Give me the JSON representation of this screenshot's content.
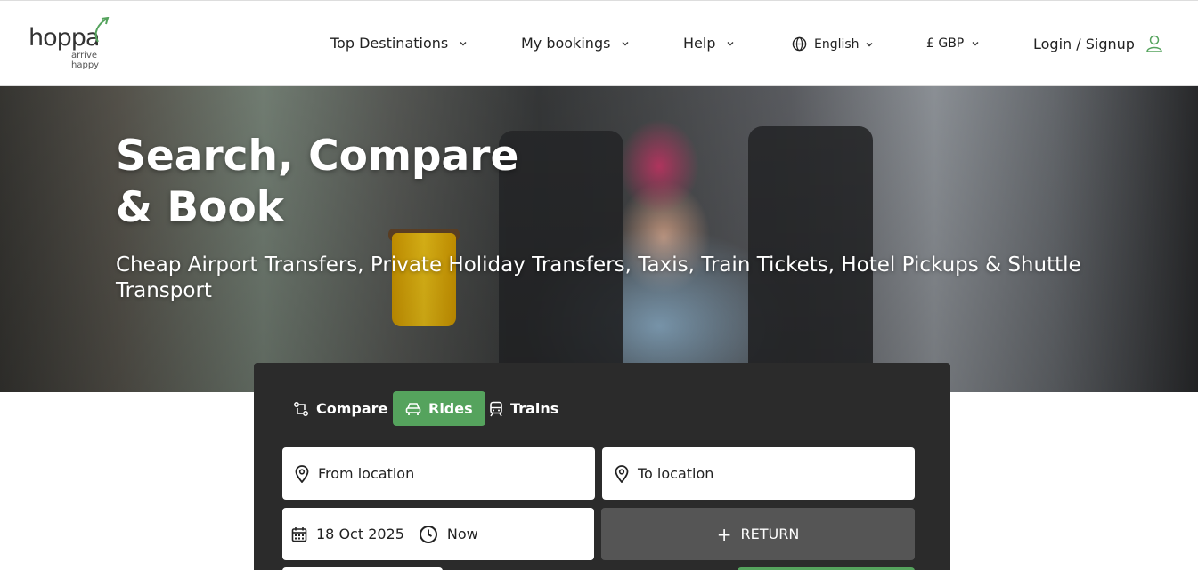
{
  "brand": {
    "name": "hoppa",
    "tagline": "arrive happy",
    "accent": "#55a35d"
  },
  "nav": {
    "top_destinations": "Top Destinations",
    "my_bookings": "My bookings",
    "help": "Help",
    "language": "English",
    "currency": "£ GBP",
    "login": "Login / Signup"
  },
  "hero": {
    "title_line1": "Search, Compare",
    "title_line2": "& Book",
    "subtitle": "Cheap Airport Transfers, Private Holiday Transfers, Taxis, Train Tickets, Hotel Pickups & Shuttle Transport"
  },
  "search": {
    "tabs": [
      {
        "label": "Compare",
        "icon": "compare-icon",
        "active": false
      },
      {
        "label": "Rides",
        "icon": "car-icon",
        "active": true
      },
      {
        "label": "Trains",
        "icon": "train-icon",
        "active": false
      }
    ],
    "from_placeholder": "From location",
    "to_placeholder": "To location",
    "date": "18 Oct 2025",
    "time": "Now",
    "return_label": "RETURN"
  }
}
